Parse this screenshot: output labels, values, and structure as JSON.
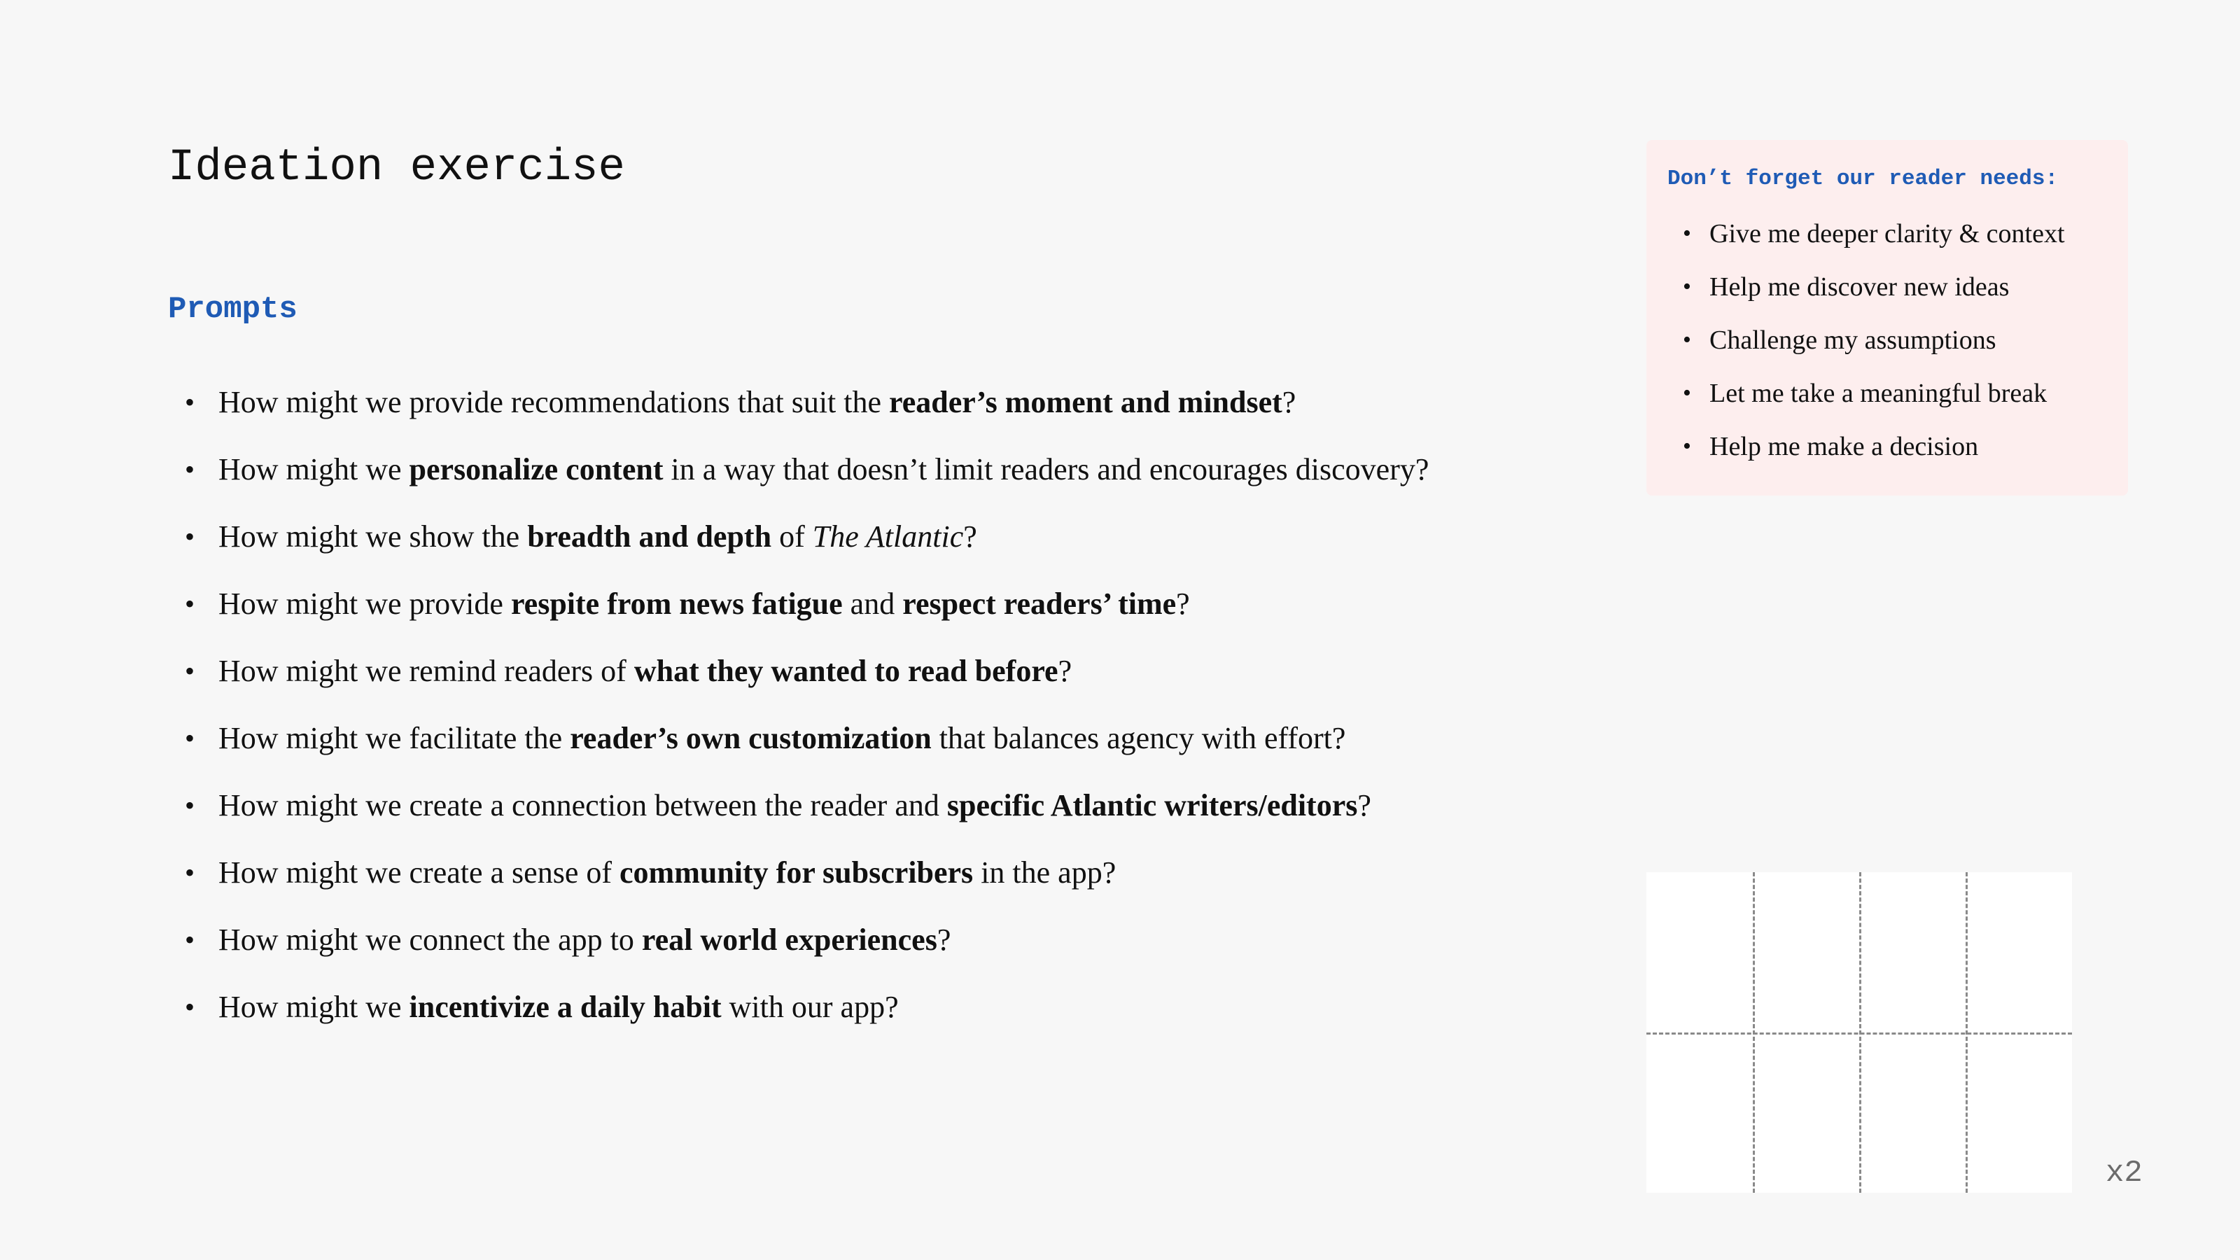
{
  "page": {
    "title": "Ideation exercise",
    "background_color": "#f7f7f7"
  },
  "prompts": {
    "heading": "Prompts",
    "heading_color": "#1f5bb5",
    "bullet": "•",
    "items": [
      [
        {
          "text": "How might we provide recommendations that suit the ",
          "style": "normal"
        },
        {
          "text": "reader’s moment and mindset",
          "style": "bold"
        },
        {
          "text": "?",
          "style": "normal"
        }
      ],
      [
        {
          "text": "How might we ",
          "style": "normal"
        },
        {
          "text": "personalize content",
          "style": "bold"
        },
        {
          "text": " in a way that doesn’t limit readers and encourages discovery?",
          "style": "normal"
        }
      ],
      [
        {
          "text": "How might we show the ",
          "style": "normal"
        },
        {
          "text": "breadth and depth",
          "style": "bold"
        },
        {
          "text": " of ",
          "style": "normal"
        },
        {
          "text": "The Atlantic",
          "style": "italic"
        },
        {
          "text": "?",
          "style": "normal"
        }
      ],
      [
        {
          "text": "How might we provide ",
          "style": "normal"
        },
        {
          "text": "respite from news fatigue",
          "style": "bold"
        },
        {
          "text": " and ",
          "style": "normal"
        },
        {
          "text": "respect readers’ time",
          "style": "bold"
        },
        {
          "text": "?",
          "style": "normal"
        }
      ],
      [
        {
          "text": "How might we remind readers of ",
          "style": "normal"
        },
        {
          "text": "what they wanted to read before",
          "style": "bold"
        },
        {
          "text": "?",
          "style": "normal"
        }
      ],
      [
        {
          "text": "How might we facilitate the ",
          "style": "normal"
        },
        {
          "text": "reader’s own customization",
          "style": "bold"
        },
        {
          "text": " that balances agency with effort?",
          "style": "normal"
        }
      ],
      [
        {
          "text": "How might we create a connection between the reader and ",
          "style": "normal"
        },
        {
          "text": "specific Atlantic writers/editors",
          "style": "bold"
        },
        {
          "text": "?",
          "style": "normal"
        }
      ],
      [
        {
          "text": "How might we create a sense of ",
          "style": "normal"
        },
        {
          "text": "community for subscribers",
          "style": "bold"
        },
        {
          "text": " in the app?",
          "style": "normal"
        }
      ],
      [
        {
          "text": "How might we connect the app to ",
          "style": "normal"
        },
        {
          "text": "real world experiences",
          "style": "bold"
        },
        {
          "text": "?",
          "style": "normal"
        }
      ],
      [
        {
          "text": "How might we ",
          "style": "normal"
        },
        {
          "text": "incentivize a daily habit",
          "style": "bold"
        },
        {
          "text": " with our app?",
          "style": "normal"
        }
      ]
    ]
  },
  "reader_needs": {
    "title": "Don’t forget our reader needs:",
    "title_color": "#1f5bb5",
    "box_color": "#fdeeee",
    "items": [
      "Give me deeper clarity & context",
      "Help me discover new ideas",
      "Challenge my assumptions",
      "Let me take a meaningful break",
      "Help me make a decision"
    ]
  },
  "sketch_grid": {
    "columns": 4,
    "rows": 2,
    "multiplier_label": "x2"
  }
}
